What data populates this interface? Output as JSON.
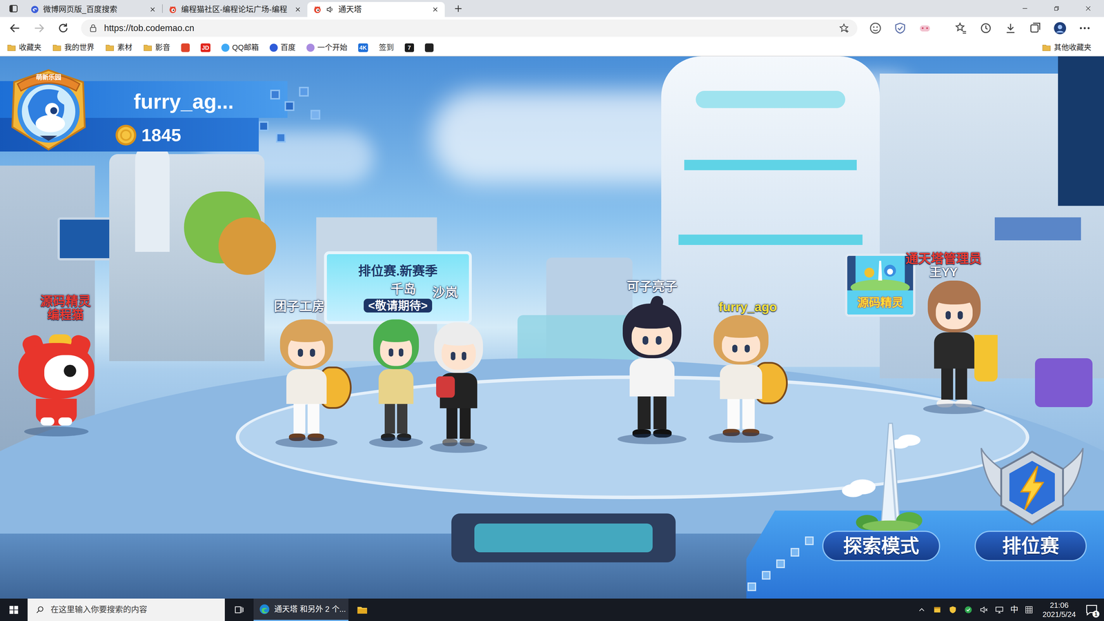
{
  "browser": {
    "tabs": [
      {
        "label": "微博网页版_百度搜索",
        "selected": false,
        "audio": false
      },
      {
        "label": "编程猫社区-编程论坛广场-编程",
        "selected": false,
        "audio": false
      },
      {
        "label": "通天塔",
        "selected": true,
        "audio": true
      }
    ],
    "nav": {
      "back_enabled": true,
      "forward_enabled": false
    },
    "address": "https://tob.codemao.cn",
    "bookmarks": [
      {
        "label": "收藏夹",
        "kind": "folder",
        "color": "#e9b949"
      },
      {
        "label": "我的世界",
        "kind": "folder",
        "color": "#e9b949"
      },
      {
        "label": "素材",
        "kind": "folder",
        "color": "#e9b949"
      },
      {
        "label": "影音",
        "kind": "folder",
        "color": "#e9b949"
      },
      {
        "label": "",
        "kind": "icon",
        "color": "#e0452b"
      },
      {
        "label": "JD",
        "kind": "badge",
        "color": "#e1251b"
      },
      {
        "label": "QQ邮箱",
        "kind": "site",
        "color": "#3fa9f5"
      },
      {
        "label": "百度",
        "kind": "site",
        "color": "#2e5bd8"
      },
      {
        "label": "一个开始",
        "kind": "site",
        "color": "#a98be0"
      },
      {
        "label": "4K",
        "kind": "badge",
        "color": "#1e6fd9"
      },
      {
        "label": "签到",
        "kind": "plain",
        "color": "#333333"
      },
      {
        "label": "7",
        "kind": "badge",
        "color": "#1a1a1a"
      },
      {
        "label": "",
        "kind": "icon",
        "color": "#222222"
      }
    ],
    "other_bookmarks": "其他收藏夹"
  },
  "game": {
    "player": {
      "badge": "萌新乐园",
      "name": "furry_ag...",
      "coins": "1845"
    },
    "ranked_board": {
      "title": "排位赛.新赛季",
      "subtitle": "<敬请期待>"
    },
    "side_board": {
      "title": "源码精灵"
    },
    "characters": [
      {
        "name": "源码精灵",
        "subtitle": "编程猫",
        "color": "#ef3b30",
        "subtitle_color": "#ef3b30",
        "kind": "cat"
      },
      {
        "name": "团子工房",
        "subtitle": "",
        "color": "#ffffff",
        "subtitle_color": "#ffffff",
        "kind": "person"
      },
      {
        "name": "千岛",
        "subtitle": "",
        "color": "#ffffff",
        "subtitle_color": "#ffffff",
        "kind": "person"
      },
      {
        "name": "沙岚",
        "subtitle": "",
        "color": "#ffffff",
        "subtitle_color": "#ffffff",
        "kind": "person"
      },
      {
        "name": "可子亮子",
        "subtitle": "",
        "color": "#ffffff",
        "subtitle_color": "#ffffff",
        "kind": "person"
      },
      {
        "name": "furry_ago",
        "subtitle": "",
        "color": "#ffe23c",
        "subtitle_color": "#ffffff",
        "kind": "person"
      },
      {
        "name": "通天塔管理员",
        "subtitle": "王YY",
        "color": "#ef3b30",
        "subtitle_color": "#ffffff",
        "kind": "person"
      }
    ],
    "buttons": [
      {
        "label": "探索模式"
      },
      {
        "label": "排位赛"
      }
    ]
  },
  "taskbar": {
    "search_placeholder": "在这里输入你要搜索的内容",
    "app_label": "通天塔 和另外 2 个...",
    "ime": "中",
    "time": "21:06",
    "date": "2021/5/24",
    "notifications": "1"
  }
}
